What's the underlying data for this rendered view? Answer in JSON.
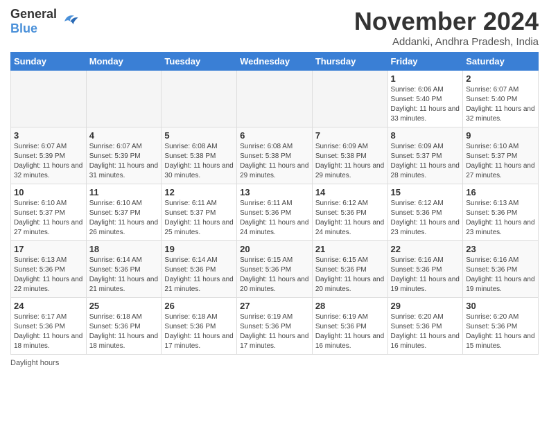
{
  "logo": {
    "general": "General",
    "blue": "Blue"
  },
  "title": "November 2024",
  "location": "Addanki, Andhra Pradesh, India",
  "headers": [
    "Sunday",
    "Monday",
    "Tuesday",
    "Wednesday",
    "Thursday",
    "Friday",
    "Saturday"
  ],
  "footer": "Daylight hours",
  "weeks": [
    [
      {
        "day": "",
        "info": ""
      },
      {
        "day": "",
        "info": ""
      },
      {
        "day": "",
        "info": ""
      },
      {
        "day": "",
        "info": ""
      },
      {
        "day": "",
        "info": ""
      },
      {
        "day": "1",
        "info": "Sunrise: 6:06 AM\nSunset: 5:40 PM\nDaylight: 11 hours and 33 minutes."
      },
      {
        "day": "2",
        "info": "Sunrise: 6:07 AM\nSunset: 5:40 PM\nDaylight: 11 hours and 32 minutes."
      }
    ],
    [
      {
        "day": "3",
        "info": "Sunrise: 6:07 AM\nSunset: 5:39 PM\nDaylight: 11 hours and 32 minutes."
      },
      {
        "day": "4",
        "info": "Sunrise: 6:07 AM\nSunset: 5:39 PM\nDaylight: 11 hours and 31 minutes."
      },
      {
        "day": "5",
        "info": "Sunrise: 6:08 AM\nSunset: 5:38 PM\nDaylight: 11 hours and 30 minutes."
      },
      {
        "day": "6",
        "info": "Sunrise: 6:08 AM\nSunset: 5:38 PM\nDaylight: 11 hours and 29 minutes."
      },
      {
        "day": "7",
        "info": "Sunrise: 6:09 AM\nSunset: 5:38 PM\nDaylight: 11 hours and 29 minutes."
      },
      {
        "day": "8",
        "info": "Sunrise: 6:09 AM\nSunset: 5:37 PM\nDaylight: 11 hours and 28 minutes."
      },
      {
        "day": "9",
        "info": "Sunrise: 6:10 AM\nSunset: 5:37 PM\nDaylight: 11 hours and 27 minutes."
      }
    ],
    [
      {
        "day": "10",
        "info": "Sunrise: 6:10 AM\nSunset: 5:37 PM\nDaylight: 11 hours and 27 minutes."
      },
      {
        "day": "11",
        "info": "Sunrise: 6:10 AM\nSunset: 5:37 PM\nDaylight: 11 hours and 26 minutes."
      },
      {
        "day": "12",
        "info": "Sunrise: 6:11 AM\nSunset: 5:37 PM\nDaylight: 11 hours and 25 minutes."
      },
      {
        "day": "13",
        "info": "Sunrise: 6:11 AM\nSunset: 5:36 PM\nDaylight: 11 hours and 24 minutes."
      },
      {
        "day": "14",
        "info": "Sunrise: 6:12 AM\nSunset: 5:36 PM\nDaylight: 11 hours and 24 minutes."
      },
      {
        "day": "15",
        "info": "Sunrise: 6:12 AM\nSunset: 5:36 PM\nDaylight: 11 hours and 23 minutes."
      },
      {
        "day": "16",
        "info": "Sunrise: 6:13 AM\nSunset: 5:36 PM\nDaylight: 11 hours and 23 minutes."
      }
    ],
    [
      {
        "day": "17",
        "info": "Sunrise: 6:13 AM\nSunset: 5:36 PM\nDaylight: 11 hours and 22 minutes."
      },
      {
        "day": "18",
        "info": "Sunrise: 6:14 AM\nSunset: 5:36 PM\nDaylight: 11 hours and 21 minutes."
      },
      {
        "day": "19",
        "info": "Sunrise: 6:14 AM\nSunset: 5:36 PM\nDaylight: 11 hours and 21 minutes."
      },
      {
        "day": "20",
        "info": "Sunrise: 6:15 AM\nSunset: 5:36 PM\nDaylight: 11 hours and 20 minutes."
      },
      {
        "day": "21",
        "info": "Sunrise: 6:15 AM\nSunset: 5:36 PM\nDaylight: 11 hours and 20 minutes."
      },
      {
        "day": "22",
        "info": "Sunrise: 6:16 AM\nSunset: 5:36 PM\nDaylight: 11 hours and 19 minutes."
      },
      {
        "day": "23",
        "info": "Sunrise: 6:16 AM\nSunset: 5:36 PM\nDaylight: 11 hours and 19 minutes."
      }
    ],
    [
      {
        "day": "24",
        "info": "Sunrise: 6:17 AM\nSunset: 5:36 PM\nDaylight: 11 hours and 18 minutes."
      },
      {
        "day": "25",
        "info": "Sunrise: 6:18 AM\nSunset: 5:36 PM\nDaylight: 11 hours and 18 minutes."
      },
      {
        "day": "26",
        "info": "Sunrise: 6:18 AM\nSunset: 5:36 PM\nDaylight: 11 hours and 17 minutes."
      },
      {
        "day": "27",
        "info": "Sunrise: 6:19 AM\nSunset: 5:36 PM\nDaylight: 11 hours and 17 minutes."
      },
      {
        "day": "28",
        "info": "Sunrise: 6:19 AM\nSunset: 5:36 PM\nDaylight: 11 hours and 16 minutes."
      },
      {
        "day": "29",
        "info": "Sunrise: 6:20 AM\nSunset: 5:36 PM\nDaylight: 11 hours and 16 minutes."
      },
      {
        "day": "30",
        "info": "Sunrise: 6:20 AM\nSunset: 5:36 PM\nDaylight: 11 hours and 15 minutes."
      }
    ]
  ]
}
